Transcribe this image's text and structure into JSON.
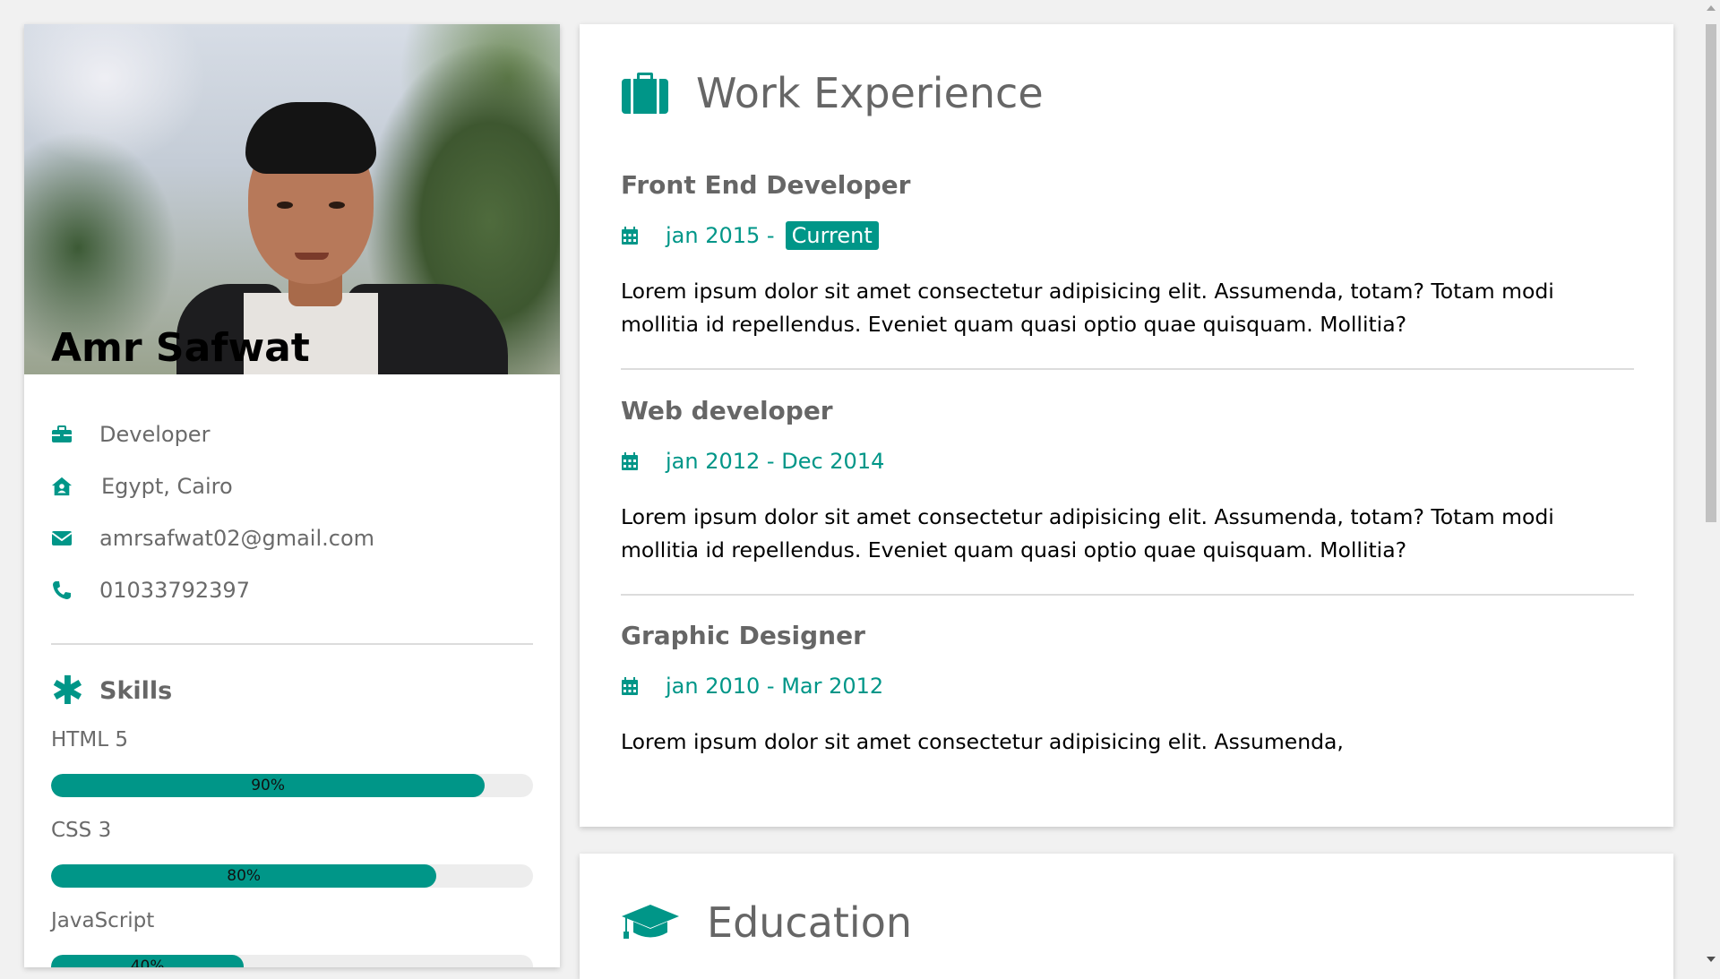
{
  "profile": {
    "name": "Amr Safwat",
    "job": "Developer",
    "location": "Egypt, Cairo",
    "email": "amrsafwat02@gmail.com",
    "phone": "01033792397"
  },
  "skills": {
    "title": "Skills",
    "items": [
      {
        "label": "HTML 5",
        "percent": "90%",
        "value": 90
      },
      {
        "label": "CSS 3",
        "percent": "80%",
        "value": 80
      },
      {
        "label": "JavaScript",
        "percent": "40%",
        "value": 40
      }
    ]
  },
  "work": {
    "title": "Work Experience",
    "jobs": [
      {
        "title": "Front End Developer",
        "date": "jan 2015 -",
        "tag": "Current",
        "text": "Lorem ipsum dolor sit amet consectetur adipisicing elit. Assumenda, totam? Totam modi mollitia id repellendus. Eveniet quam quasi optio quae quisquam. Mollitia?"
      },
      {
        "title": "Web developer",
        "date": "jan 2012 - Dec 2014",
        "text": "Lorem ipsum dolor sit amet consectetur adipisicing elit. Assumenda, totam? Totam modi mollitia id repellendus. Eveniet quam quasi optio quae quisquam. Mollitia?"
      },
      {
        "title": "Graphic Designer",
        "date": "jan 2010 - Mar 2012",
        "text": "Lorem ipsum dolor sit amet consectetur adipisicing elit. Assumenda,"
      }
    ]
  },
  "education": {
    "title": "Education"
  },
  "colors": {
    "accent": "#009688",
    "heading_gray": "#666666",
    "background": "#f1f1f1"
  },
  "icons": {
    "job": "briefcase-icon",
    "location": "home-icon",
    "email": "envelope-icon",
    "phone": "phone-icon",
    "skills": "asterisk-icon",
    "work": "suitcase-icon",
    "date": "calendar-icon",
    "education": "graduation-cap-icon"
  }
}
